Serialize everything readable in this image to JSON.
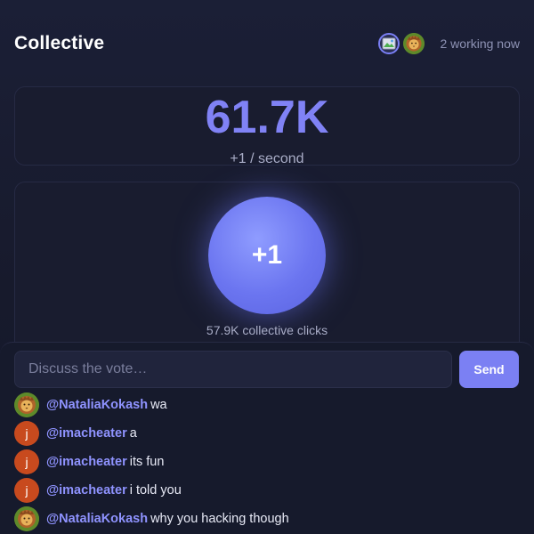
{
  "app": {
    "title": "Collective"
  },
  "presence": {
    "status_text": "2 working now",
    "avatars": [
      "broken-image-icon",
      "lion-icon"
    ]
  },
  "counter": {
    "value": "61.7K",
    "rate": "+1 / second"
  },
  "clicker": {
    "button_label": "+1",
    "collective_clicks": "57.9K collective clicks"
  },
  "chat": {
    "placeholder": "Discuss the vote…",
    "send_label": "Send",
    "messages": [
      {
        "avatar": "lion-icon",
        "user": "@NataliaKokash",
        "text": "wa"
      },
      {
        "avatar": "j",
        "user": "@imacheater",
        "text": "a"
      },
      {
        "avatar": "j",
        "user": "@imacheater",
        "text": "its fun"
      },
      {
        "avatar": "j",
        "user": "@imacheater",
        "text": "i told you"
      },
      {
        "avatar": "lion-icon",
        "user": "@NataliaKokash",
        "text": "why you hacking though"
      }
    ]
  },
  "colors": {
    "accent": "#7b80f3",
    "counter": "#8082f5",
    "username": "#8f93ff",
    "initial_avatar": "#c84a1e"
  }
}
